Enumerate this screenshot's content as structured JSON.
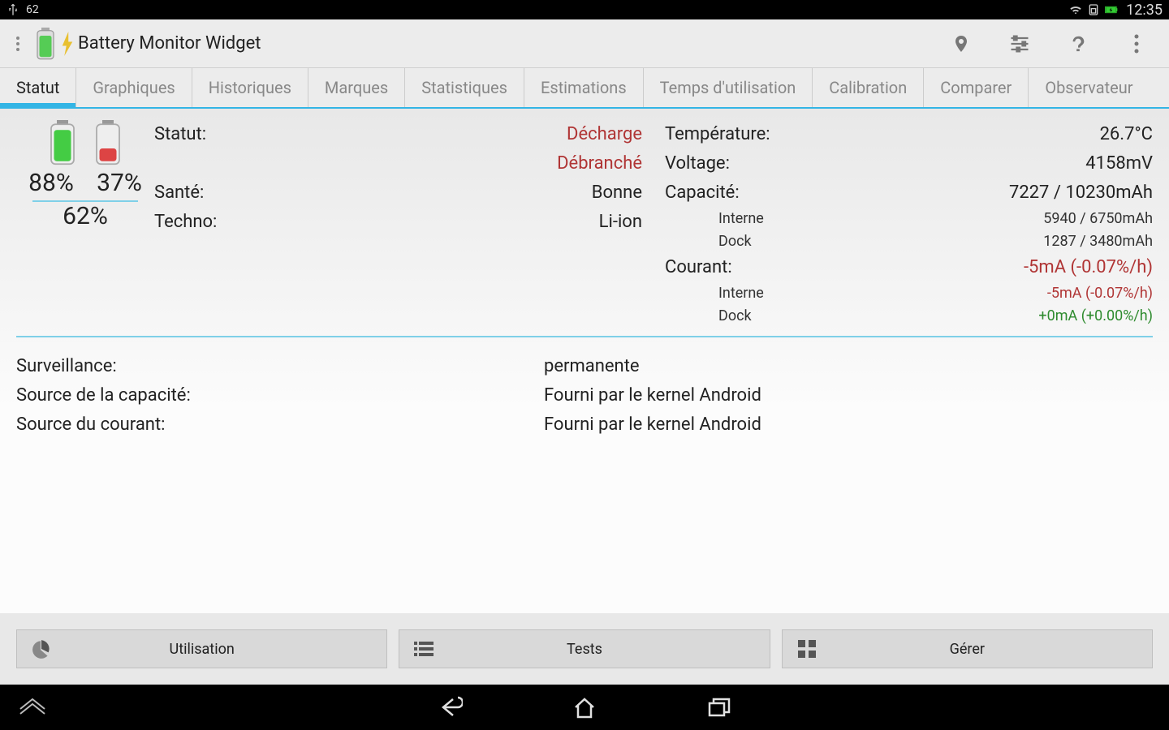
{
  "status_bar": {
    "temp": "62",
    "clock": "12:35"
  },
  "app": {
    "title": "Battery Monitor Widget"
  },
  "tabs": [
    "Statut",
    "Graphiques",
    "Historiques",
    "Marques",
    "Statistiques",
    "Estimations",
    "Temps d'utilisation",
    "Calibration",
    "Comparer",
    "Observateur"
  ],
  "active_tab_index": 0,
  "battery": {
    "pct_internal": "88%",
    "pct_dock": "37%",
    "pct_total": "62%"
  },
  "left_col": {
    "statut_label": "Statut:",
    "statut_value": "Décharge",
    "plug_value": "Débranché",
    "sante_label": "Santé:",
    "sante_value": "Bonne",
    "techno_label": "Techno:",
    "techno_value": "Li-ion"
  },
  "right_col": {
    "temp_label": "Température:",
    "temp_value": "26.7°C",
    "volt_label": "Voltage:",
    "volt_value": "4158mV",
    "cap_label": "Capacité:",
    "cap_value": "7227 / 10230mAh",
    "cap_int_label": "Interne",
    "cap_int_value": "5940 / 6750mAh",
    "cap_dock_label": "Dock",
    "cap_dock_value": "1287 / 3480mAh",
    "cur_label": "Courant:",
    "cur_value": "-5mA (-0.07%/h)",
    "cur_int_label": "Interne",
    "cur_int_value": "-5mA (-0.07%/h)",
    "cur_dock_label": "Dock",
    "cur_dock_value": "+0mA (+0.00%/h)"
  },
  "mid": {
    "surv_label": "Surveillance:",
    "surv_value": "permanente",
    "cap_src_label": "Source de la capacité:",
    "cap_src_value": "Fourni par le kernel Android",
    "cur_src_label": "Source du courant:",
    "cur_src_value": "Fourni par le kernel Android"
  },
  "buttons": {
    "util": "Utilisation",
    "tests": "Tests",
    "manage": "Gérer"
  }
}
